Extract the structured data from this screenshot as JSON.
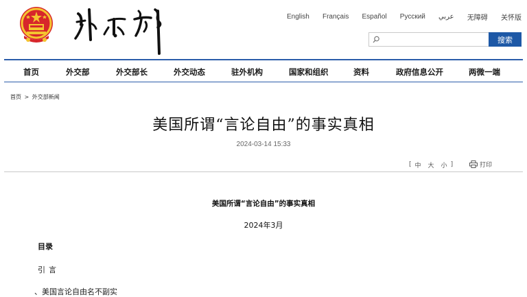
{
  "header": {
    "languages": [
      "English",
      "Français",
      "Español",
      "Русский",
      "عربي",
      "无障碍",
      "关怀版"
    ],
    "search": {
      "placeholder": "",
      "button_label": "搜索"
    },
    "accent_color": "#1d58a6"
  },
  "nav": {
    "items": [
      "首页",
      "外交部",
      "外交部长",
      "外交动态",
      "驻外机构",
      "国家和组织",
      "资料",
      "政府信息公开",
      "两微一端"
    ]
  },
  "breadcrumb": [
    "首页",
    ">",
    "外交部新闻"
  ],
  "article": {
    "title": "美国所谓“言论自由”的事实真相",
    "date": "2024-03-14 15:33",
    "font_size_controls": {
      "open": "[",
      "large": "中",
      "medium": "大",
      "small": "小",
      "close": "]"
    },
    "print_label": "打印"
  },
  "body": {
    "title": "美国所谓“言论自由”的事实真相",
    "date": "2024年3月",
    "toc_heading": "目录",
    "toc_items": [
      "引言",
      "、美国言论自由名不副实"
    ]
  }
}
